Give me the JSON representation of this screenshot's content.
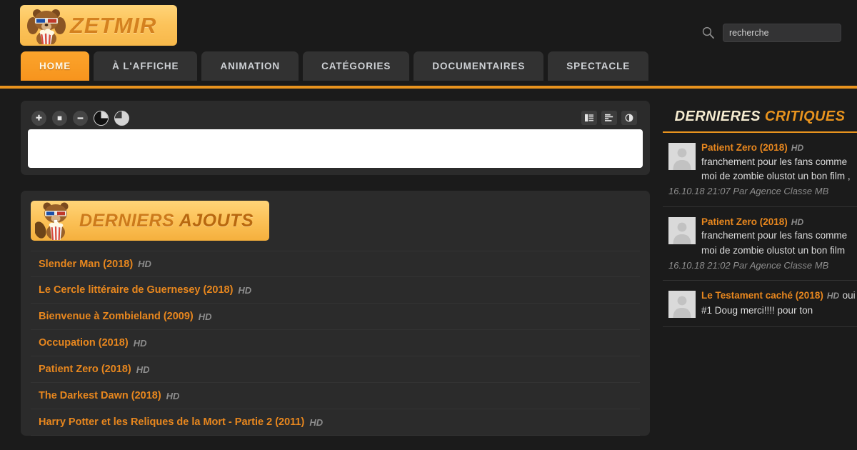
{
  "site": {
    "logo_text": "ZETMIR",
    "logo_icon": "bear-3d-glasses-popcorn-icon",
    "accent_color": "#e8931e",
    "title_orange": "#e8871e",
    "background": "#1b1b1b",
    "panel_background": "#2b2b2b"
  },
  "search": {
    "icon": "search-icon",
    "placeholder": "recherche",
    "value": ""
  },
  "nav": {
    "items": [
      {
        "label": "HOME",
        "active": true
      },
      {
        "label": "À L'AFFICHE",
        "active": false
      },
      {
        "label": "ANIMATION",
        "active": false
      },
      {
        "label": "CATÉGORIES",
        "active": false
      },
      {
        "label": "DOCUMENTAIRES",
        "active": false
      },
      {
        "label": "SPECTACLE",
        "active": false
      }
    ]
  },
  "player": {
    "left_tools": [
      {
        "name": "zoom-in-icon",
        "glyph": "plus"
      },
      {
        "name": "stop-square-icon",
        "glyph": "square"
      },
      {
        "name": "zoom-out-icon",
        "glyph": "minus"
      },
      {
        "name": "contrast-dark-icon",
        "glyph": "pie-dark"
      },
      {
        "name": "contrast-light-icon",
        "glyph": "pie-light"
      }
    ],
    "right_tools": [
      {
        "name": "text-layout-icon",
        "glyph": "lines-left"
      },
      {
        "name": "align-layout-icon",
        "glyph": "lines-bars"
      },
      {
        "name": "split-contrast-icon",
        "glyph": "half-circle"
      }
    ]
  },
  "latest_added": {
    "title_part1": "DERNIERS",
    "title_part2": "AJOUTS",
    "mascot_icon": "beaver-3d-glasses-popcorn-icon",
    "items": [
      {
        "title": "Slender Man (2018)",
        "quality": "HD"
      },
      {
        "title": "Le Cercle littéraire de Guernesey (2018)",
        "quality": "HD"
      },
      {
        "title": "Bienvenue à Zombieland (2009)",
        "quality": "HD"
      },
      {
        "title": "Occupation (2018)",
        "quality": "HD"
      },
      {
        "title": "Patient Zero (2018)",
        "quality": "HD"
      },
      {
        "title": "The Darkest Dawn (2018)",
        "quality": "HD"
      },
      {
        "title": "Harry Potter et les Reliques de la Mort - Partie 2 (2011)",
        "quality": "HD"
      }
    ]
  },
  "sidebar": {
    "heading_part1": "DERNIERES",
    "heading_part2": "CRITIQUES",
    "reviews": [
      {
        "avatar": "user-placeholder-avatar",
        "movie": "Patient Zero (2018)",
        "quality": "HD",
        "text": "franchement pour les fans comme moi de zombie olustot un bon film ,",
        "meta": "16.10.18 21:07 Par Agence Classe MB"
      },
      {
        "avatar": "user-placeholder-avatar",
        "movie": "Patient Zero (2018)",
        "quality": "HD",
        "text": "franchement pour les fans comme moi de zombie olustot un bon film",
        "meta": "16.10.18 21:02 Par Agence Classe MB"
      },
      {
        "avatar": "user-placeholder-avatar",
        "movie": "Le Testament caché (2018)",
        "quality": "HD",
        "text": "oui #1 Doug merci!!!! pour ton",
        "meta": ""
      }
    ]
  }
}
